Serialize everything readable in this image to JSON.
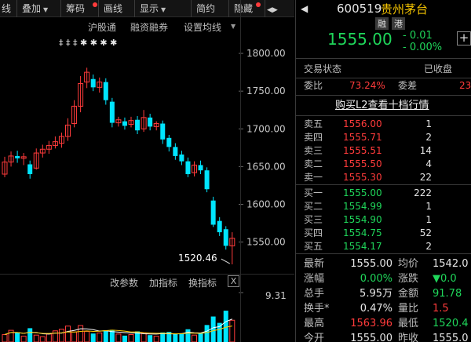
{
  "toolbar": {
    "items": [
      {
        "label": "叠加",
        "has_caret": true,
        "dot": false
      },
      {
        "label": "筹码",
        "has_caret": false,
        "dot": true
      },
      {
        "label": "画线",
        "has_caret": false,
        "dot": false
      },
      {
        "label": "显示",
        "has_caret": true,
        "dot": false
      },
      {
        "label": "简约",
        "has_caret": false,
        "dot": false
      },
      {
        "label": "隐藏",
        "has_caret": false,
        "dot": true
      }
    ],
    "left_fragment": "线",
    "nav_arrows": "◀▶"
  },
  "chart_toolbar": {
    "links": [
      "沪股通",
      "融资融券",
      "设置均线"
    ],
    "marker_rows": "‡ ‡   ‡           ✱   ✱ ✱       ✱"
  },
  "chart_data": {
    "type": "candlestick",
    "y_axis_ticks": [
      "1800.00",
      "1750.00",
      "1700.00",
      "1650.00",
      "1600.00",
      "1550.00"
    ],
    "ylim": [
      1508,
      1825
    ],
    "annotation": "1520.46",
    "candles": [
      {
        "o": 1640,
        "c": 1656,
        "h": 1663,
        "l": 1636
      },
      {
        "o": 1656,
        "c": 1664,
        "h": 1670,
        "l": 1650
      },
      {
        "o": 1664,
        "c": 1661,
        "h": 1671,
        "l": 1655
      },
      {
        "o": 1661,
        "c": 1663,
        "h": 1668,
        "l": 1652
      },
      {
        "o": 1653,
        "c": 1640,
        "h": 1658,
        "l": 1634
      },
      {
        "o": 1648,
        "c": 1668,
        "h": 1674,
        "l": 1646
      },
      {
        "o": 1668,
        "c": 1673,
        "h": 1679,
        "l": 1662
      },
      {
        "o": 1673,
        "c": 1678,
        "h": 1684,
        "l": 1667
      },
      {
        "o": 1678,
        "c": 1683,
        "h": 1690,
        "l": 1674
      },
      {
        "o": 1681,
        "c": 1690,
        "h": 1695,
        "l": 1675
      },
      {
        "o": 1690,
        "c": 1705,
        "h": 1714,
        "l": 1684
      },
      {
        "o": 1707,
        "c": 1730,
        "h": 1738,
        "l": 1702
      },
      {
        "o": 1730,
        "c": 1760,
        "h": 1770,
        "l": 1722
      },
      {
        "o": 1762,
        "c": 1775,
        "h": 1781,
        "l": 1754
      },
      {
        "o": 1766,
        "c": 1755,
        "h": 1772,
        "l": 1750
      },
      {
        "o": 1755,
        "c": 1762,
        "h": 1768,
        "l": 1748
      },
      {
        "o": 1762,
        "c": 1738,
        "h": 1767,
        "l": 1732
      },
      {
        "o": 1736,
        "c": 1708,
        "h": 1741,
        "l": 1702
      },
      {
        "o": 1708,
        "c": 1712,
        "h": 1716,
        "l": 1703
      },
      {
        "o": 1710,
        "c": 1704,
        "h": 1715,
        "l": 1699
      },
      {
        "o": 1706,
        "c": 1711,
        "h": 1716,
        "l": 1702
      },
      {
        "o": 1712,
        "c": 1698,
        "h": 1717,
        "l": 1693
      },
      {
        "o": 1700,
        "c": 1715,
        "h": 1725,
        "l": 1696
      },
      {
        "o": 1715,
        "c": 1703,
        "h": 1720,
        "l": 1698
      },
      {
        "o": 1703,
        "c": 1707,
        "h": 1710,
        "l": 1698
      },
      {
        "o": 1707,
        "c": 1686,
        "h": 1711,
        "l": 1680
      },
      {
        "o": 1688,
        "c": 1676,
        "h": 1692,
        "l": 1670
      },
      {
        "o": 1676,
        "c": 1664,
        "h": 1681,
        "l": 1659
      },
      {
        "o": 1666,
        "c": 1657,
        "h": 1671,
        "l": 1652
      },
      {
        "o": 1657,
        "c": 1640,
        "h": 1662,
        "l": 1636
      },
      {
        "o": 1642,
        "c": 1652,
        "h": 1657,
        "l": 1637
      },
      {
        "o": 1652,
        "c": 1645,
        "h": 1658,
        "l": 1640
      },
      {
        "o": 1645,
        "c": 1620,
        "h": 1649,
        "l": 1616
      },
      {
        "o": 1605,
        "c": 1573,
        "h": 1610,
        "l": 1570
      },
      {
        "o": 1578,
        "c": 1563,
        "h": 1583,
        "l": 1558
      },
      {
        "o": 1567,
        "c": 1545,
        "h": 1571,
        "l": 1540
      },
      {
        "o": 1545,
        "c": 1555,
        "h": 1563,
        "l": 1520.46
      }
    ]
  },
  "volume_panel": {
    "buttons": [
      "改参数",
      "加指标",
      "换指标"
    ],
    "close_label": "X",
    "axis_label": "9.31",
    "volumes": [
      1.4,
      2.2,
      1.8,
      1.1,
      2.6,
      1.3,
      1.0,
      1.5,
      2.1,
      2.4,
      3.0,
      1.9,
      3.1,
      2.0,
      1.6,
      1.7,
      2.2,
      2.3,
      1.5,
      1.2,
      1.4,
      2.0,
      1.7,
      1.3,
      1.1,
      1.8,
      1.9,
      1.5,
      1.6,
      2.4,
      1.3,
      1.7,
      3.2,
      4.8,
      3.6,
      5.9,
      4.1
    ],
    "vol_max": 9.31
  },
  "quote_panel": {
    "code": "600519",
    "name": "贵州茅台",
    "tag1": "融",
    "tag2": "港",
    "price": "1555.00",
    "change": "- 0.01",
    "change_pct": "- 0.00%",
    "status_label": "交易状态",
    "status_value": "已收盘",
    "weibi_label": "委比",
    "weibi_value": "73.24%",
    "weicha_label": "委差",
    "weicha_value": "23",
    "l2_link": "购买L2查看十档行情",
    "asks": [
      {
        "label": "卖五",
        "price": "1556.00",
        "vol": "1"
      },
      {
        "label": "卖四",
        "price": "1555.71",
        "vol": "2"
      },
      {
        "label": "卖三",
        "price": "1555.51",
        "vol": "14"
      },
      {
        "label": "卖二",
        "price": "1555.50",
        "vol": "4"
      },
      {
        "label": "卖一",
        "price": "1555.30",
        "vol": "22"
      }
    ],
    "bids": [
      {
        "label": "买一",
        "price": "1555.00",
        "vol": "222"
      },
      {
        "label": "买二",
        "price": "1554.99",
        "vol": "1"
      },
      {
        "label": "买三",
        "price": "1554.90",
        "vol": "1"
      },
      {
        "label": "买四",
        "price": "1554.75",
        "vol": "52"
      },
      {
        "label": "买五",
        "price": "1554.17",
        "vol": "2"
      }
    ],
    "stats": [
      {
        "l1": "最新",
        "v1": "1555.00",
        "c1": "white",
        "l2": "均价",
        "v2": "1542.0",
        "c2": "white"
      },
      {
        "l1": "涨幅",
        "v1": "0.00%",
        "c1": "green",
        "l2": "涨跌",
        "v2": "▼0.0",
        "c2": "green"
      },
      {
        "l1": "总手",
        "v1": "5.95万",
        "c1": "white",
        "l2": "金额",
        "v2": "91.78",
        "c2": "green"
      },
      {
        "l1": "换手*",
        "v1": "0.47%",
        "c1": "white",
        "l2": "量比",
        "v2": "1.5",
        "c2": "red"
      },
      {
        "l1": "最高",
        "v1": "1563.96",
        "c1": "red",
        "l2": "最低",
        "v2": "1520.4",
        "c2": "green"
      },
      {
        "l1": "今开",
        "v1": "1555.00",
        "c1": "white",
        "l2": "昨收",
        "v2": "1555.0",
        "c2": "white"
      }
    ]
  },
  "colors": {
    "up": "#ff3b3b",
    "down": "#00e5ff",
    "green": "#1fd65a",
    "bg": "#000000"
  }
}
